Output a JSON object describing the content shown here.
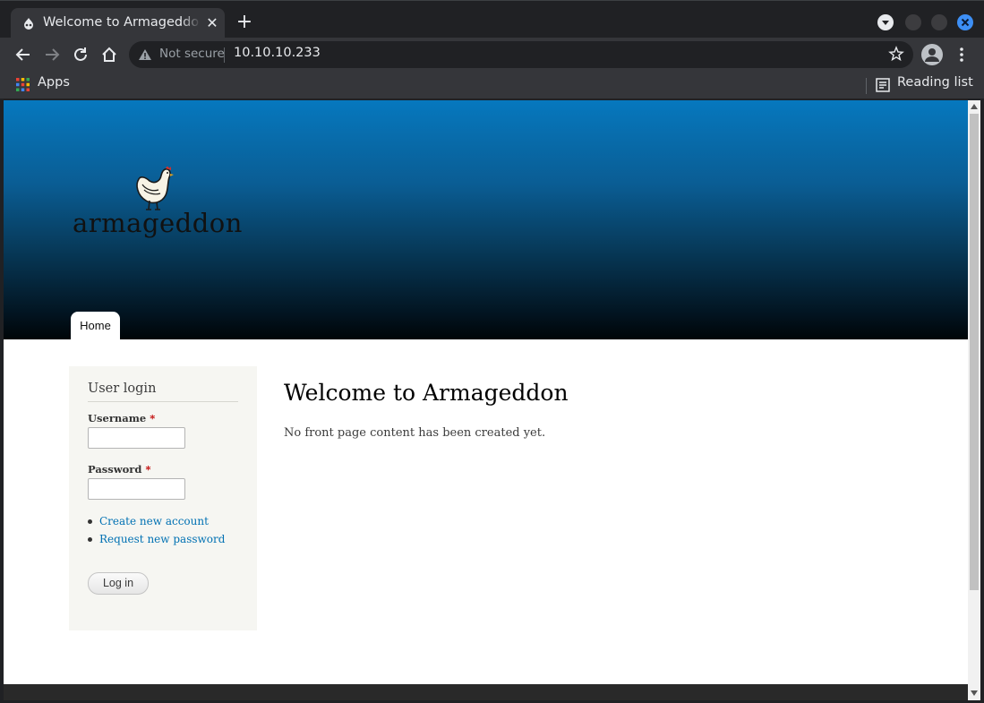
{
  "browser": {
    "tab": {
      "title": "Welcome to Armageddon",
      "favicon": "drupal-drop-icon"
    },
    "new_tab_icon": "plus-icon",
    "close_tab_icon": "close-icon",
    "security": {
      "label": "Not secure",
      "icon": "warning-triangle-icon"
    },
    "url": "10.10.10.233",
    "bookmarks": {
      "apps_label": "Apps",
      "reading_list_label": "Reading list"
    },
    "window_controls": {
      "close_color": "#3d8ff5"
    }
  },
  "site": {
    "logo_text": "armageddon",
    "nav": {
      "home_label": "Home"
    },
    "header_colors": {
      "top": "#0678be",
      "bottom": "#000507"
    },
    "login_block": {
      "title": "User login",
      "username_label": "Username",
      "password_label": "Password",
      "required_marker": "*",
      "username_value": "",
      "password_value": "",
      "links": [
        "Create new account",
        "Request new password"
      ],
      "login_button": "Log in"
    },
    "main": {
      "title": "Welcome to Armageddon",
      "text": "No front page content has been created yet."
    },
    "link_color": "#0071b3"
  }
}
